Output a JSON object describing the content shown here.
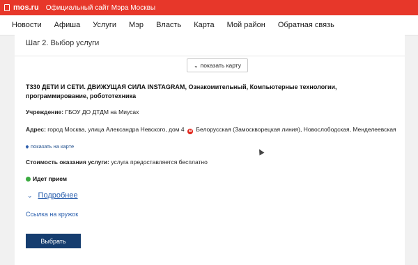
{
  "topbar": {
    "brand": "mos.ru",
    "site_title": "Официальный сайт Мэра Москвы"
  },
  "nav": {
    "items": [
      "Новости",
      "Афиша",
      "Услуги",
      "Мэр",
      "Власть",
      "Карта",
      "Мой район",
      "Обратная связь"
    ]
  },
  "main": {
    "step_title": "Шаг 2. Выбор услуги",
    "show_map_button": "показать карту",
    "course_title": "Т330 ДЕТИ И СЕТИ. ДВИЖУЩАЯ СИЛА INSTAGRAM",
    "course_tags": ", Ознакомительный, Компьютерные технологии, программирование, робототехника",
    "institution_label": "Учреждение:",
    "institution_value": "ГБОУ ДО ДТДМ на Миусах",
    "address_label": "Адрес:",
    "address_value": "город Москва, улица Александра Невского, дом 4",
    "metro_icon": "metro-icon",
    "address_metro": "Белорусская (Замоскворецкая линия), Новослободская, Менделеевская",
    "show_on_map": "показать на карте",
    "cost_label": "Стоимость оказания услуги:",
    "cost_value": "услуга предоставляется бесплатно",
    "status": "Идет прием",
    "status_color": "#3bab40",
    "more": "Подробнее",
    "club_link": "Ссылка на кружок",
    "select_button": "Выбрать"
  },
  "colors": {
    "topbar": "#e7372a",
    "button": "#153d6f",
    "link": "#2a5fae"
  }
}
